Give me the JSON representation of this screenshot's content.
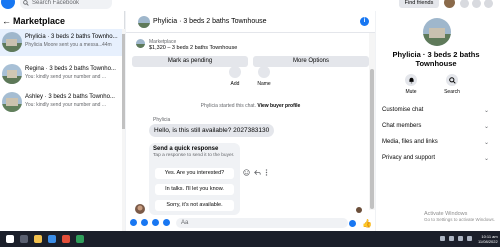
{
  "topbar": {
    "search_placeholder": "Search Facebook",
    "find_friends": "Find friends"
  },
  "sidebar": {
    "title": "Marketplace",
    "back": "←",
    "items": [
      {
        "name": "Phylicia · 3 beds 2 baths Townho...",
        "preview": "Phylicia Moore sent you a messa...",
        "time": "44m"
      },
      {
        "name": "Regina · 3 beds 2 baths Townho...",
        "preview": "You: kindly send your number and ...",
        "time": ""
      },
      {
        "name": "Ashley · 3 beds 2 baths Townho...",
        "preview": "You: kindly send your number and ...",
        "time": ""
      }
    ]
  },
  "chat": {
    "title": "Phylicia · 3 beds 2 baths Townhouse",
    "info_glyph": "i",
    "marketplace_label": "Marketplace",
    "listing": "$1,320 – 3 beds 2 baths Townhouse",
    "mark_pending": "Mark as pending",
    "more_options": "More Options",
    "add_label": "Add",
    "name_label": "Name",
    "started_prefix": "Phylicia started this chat.",
    "view_profile": "View buyer profile",
    "sender": "Phylicia",
    "message": "Hello, is this still available? 2027383130",
    "quick_reply": {
      "title": "Send a quick response",
      "subtitle": "Tap a response to send it to the buyer.",
      "options": [
        "Yes. Are you interested?",
        "In talks. I'll let you know.",
        "Sorry, it's not available."
      ]
    },
    "composer_placeholder": "Aa",
    "like_glyph": "👍"
  },
  "profile": {
    "name": "Phylicia · 3 beds 2 baths Townhouse",
    "mute": "Mute",
    "search": "Search",
    "rows": [
      "Customise chat",
      "Chat members",
      "Media, files and links",
      "Privacy and support"
    ]
  },
  "system": {
    "activate_title": "Activate Windows",
    "activate_sub": "Go to Settings to activate Windows.",
    "clock_time": "10:11 am",
    "clock_date": "11/08/2022"
  },
  "colors": {
    "accent": "#1877f2",
    "active_row": "#e7f0fd",
    "panel_bg": "#f0f2f5"
  }
}
